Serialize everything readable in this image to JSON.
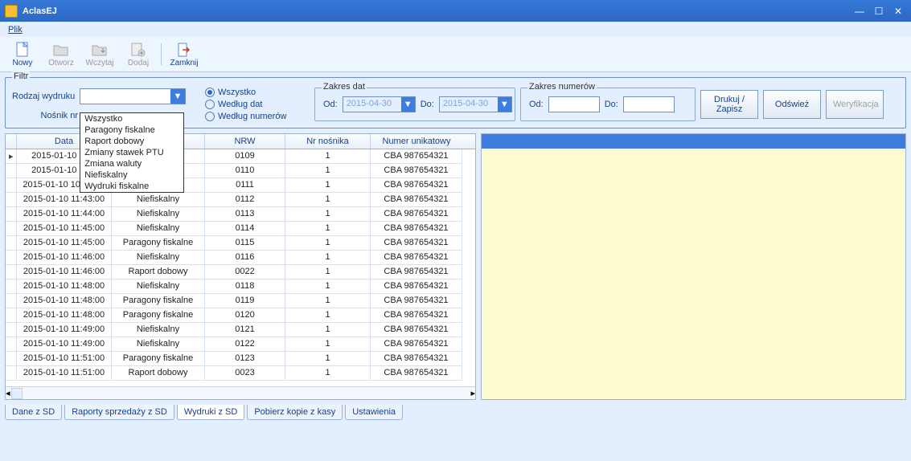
{
  "window_title": "AclasEJ",
  "menu": {
    "plik": "Plik"
  },
  "toolbar": {
    "nowy": "Nowy",
    "otworz": "Otworz",
    "wczytaj": "Wczytaj",
    "dodaj": "Dodaj",
    "zamknij": "Zamknij"
  },
  "filter": {
    "legend": "Filtr",
    "rodzaj_label": "Rodzaj wydruku",
    "nosnik_label": "Nośnik nr",
    "options": [
      "Wszystko",
      "Paragony fiskalne",
      "Raport dobowy",
      "Zmiany stawek PTU",
      "Zmiana waluty",
      "Niefiskalny",
      "Wydruki fiskalne"
    ],
    "radios": {
      "wszystko": "Wszystko",
      "wedlug_dat": "Według dat",
      "wedlug_num": "Według numerów"
    },
    "zakres_dat": {
      "legend": "Zakres dat",
      "od": "Od:",
      "do": "Do:",
      "od_val": "2015-04-30",
      "do_val": "2015-04-30"
    },
    "zakres_num": {
      "legend": "Zakres numerów",
      "od": "Od:",
      "do": "Do:"
    }
  },
  "buttons": {
    "drukuj_l1": "Drukuj /",
    "drukuj_l2": "Zapisz",
    "odswiez": "Odśwież",
    "weryf": "Weryfikacja"
  },
  "grid": {
    "headers": {
      "data": "Data",
      "rodzaj": "",
      "nrw": "NRW",
      "nrnosnika": "Nr nośnika",
      "numer": "Numer unikatowy"
    },
    "rows": [
      {
        "data": "2015-01-10 10:5",
        "rodzaj": "",
        "nrw": "0109",
        "nrn": "1",
        "num": "CBA 987654321"
      },
      {
        "data": "2015-01-10 10:5",
        "rodzaj": "",
        "nrw": "0110",
        "nrn": "1",
        "num": "CBA 987654321"
      },
      {
        "data": "2015-01-10 10:58:00",
        "rodzaj": "Niefiskalny",
        "nrw": "0111",
        "nrn": "1",
        "num": "CBA 987654321"
      },
      {
        "data": "2015-01-10 11:43:00",
        "rodzaj": "Niefiskalny",
        "nrw": "0112",
        "nrn": "1",
        "num": "CBA 987654321"
      },
      {
        "data": "2015-01-10 11:44:00",
        "rodzaj": "Niefiskalny",
        "nrw": "0113",
        "nrn": "1",
        "num": "CBA 987654321"
      },
      {
        "data": "2015-01-10 11:45:00",
        "rodzaj": "Niefiskalny",
        "nrw": "0114",
        "nrn": "1",
        "num": "CBA 987654321"
      },
      {
        "data": "2015-01-10 11:45:00",
        "rodzaj": "Paragony fiskalne",
        "nrw": "0115",
        "nrn": "1",
        "num": "CBA 987654321"
      },
      {
        "data": "2015-01-10 11:46:00",
        "rodzaj": "Niefiskalny",
        "nrw": "0116",
        "nrn": "1",
        "num": "CBA 987654321"
      },
      {
        "data": "2015-01-10 11:46:00",
        "rodzaj": "Raport dobowy",
        "nrw": "0022",
        "nrn": "1",
        "num": "CBA 987654321"
      },
      {
        "data": "2015-01-10 11:48:00",
        "rodzaj": "Niefiskalny",
        "nrw": "0118",
        "nrn": "1",
        "num": "CBA 987654321"
      },
      {
        "data": "2015-01-10 11:48:00",
        "rodzaj": "Paragony fiskalne",
        "nrw": "0119",
        "nrn": "1",
        "num": "CBA 987654321"
      },
      {
        "data": "2015-01-10 11:48:00",
        "rodzaj": "Paragony fiskalne",
        "nrw": "0120",
        "nrn": "1",
        "num": "CBA 987654321"
      },
      {
        "data": "2015-01-10 11:49:00",
        "rodzaj": "Niefiskalny",
        "nrw": "0121",
        "nrn": "1",
        "num": "CBA 987654321"
      },
      {
        "data": "2015-01-10 11:49:00",
        "rodzaj": "Niefiskalny",
        "nrw": "0122",
        "nrn": "1",
        "num": "CBA 987654321"
      },
      {
        "data": "2015-01-10 11:51:00",
        "rodzaj": "Paragony fiskalne",
        "nrw": "0123",
        "nrn": "1",
        "num": "CBA 987654321"
      },
      {
        "data": "2015-01-10 11:51:00",
        "rodzaj": "Raport dobowy",
        "nrw": "0023",
        "nrn": "1",
        "num": "CBA 987654321"
      }
    ]
  },
  "tabs": {
    "t1": "Dane z SD",
    "t2": "Raporty sprzedaży z SD",
    "t3": "Wydruki z SD",
    "t4": "Pobierz kopie z kasy",
    "t5": "Ustawienia"
  }
}
